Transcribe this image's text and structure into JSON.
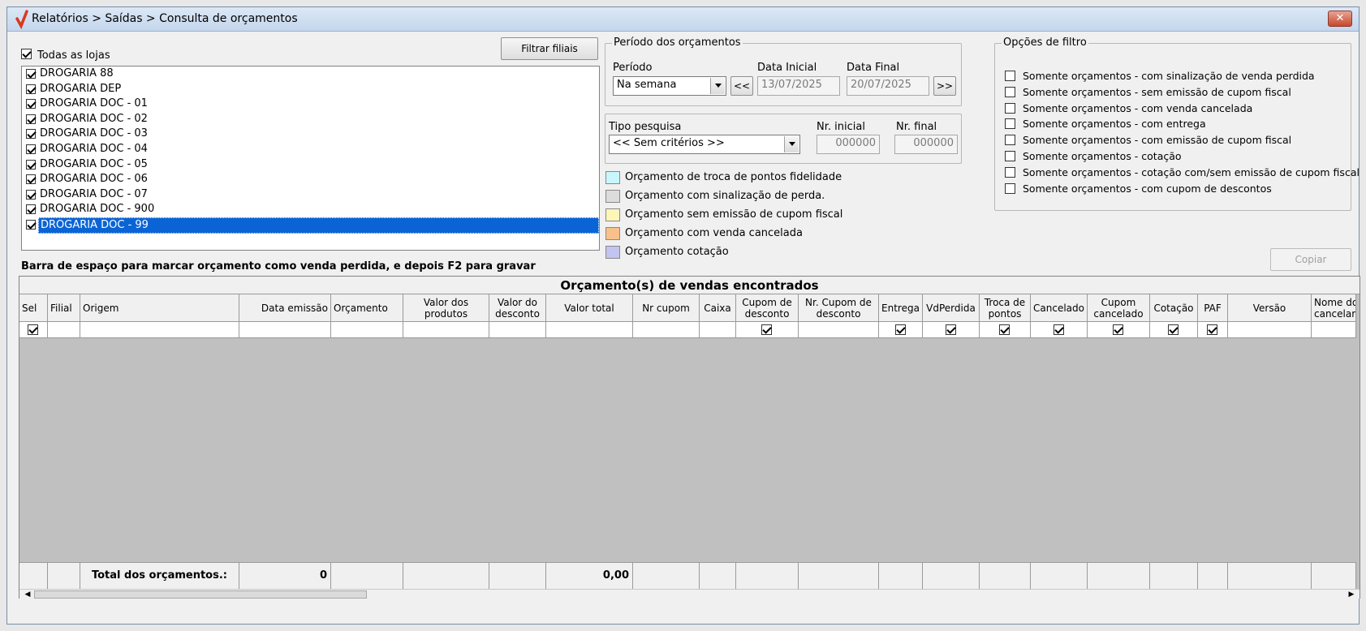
{
  "window": {
    "title": "Relatórios > Saídas > Consulta de orçamentos",
    "close_label": "✕"
  },
  "stores": {
    "all_label": "Todas as lojas",
    "all_checked": true,
    "filter_button": "Filtrar filiais",
    "items": [
      {
        "name": "DROGARIA 88",
        "checked": true
      },
      {
        "name": "DROGARIA DEP",
        "checked": true
      },
      {
        "name": "DROGARIA DOC - 01",
        "checked": true
      },
      {
        "name": "DROGARIA DOC - 02",
        "checked": true
      },
      {
        "name": "DROGARIA DOC - 03",
        "checked": true
      },
      {
        "name": "DROGARIA DOC - 04",
        "checked": true
      },
      {
        "name": "DROGARIA DOC - 05",
        "checked": true
      },
      {
        "name": "DROGARIA DOC - 06",
        "checked": true
      },
      {
        "name": "DROGARIA DOC - 07",
        "checked": true
      },
      {
        "name": "DROGARIA DOC - 900",
        "checked": true
      },
      {
        "name": "DROGARIA DOC - 99",
        "checked": true,
        "selected": true
      }
    ]
  },
  "period": {
    "legend": "Período dos orçamentos",
    "period_label": "Período",
    "period_value": "Na semana",
    "start_label": "Data Inicial",
    "start_value": "13/07/2025",
    "end_label": "Data Final",
    "end_value": "20/07/2025",
    "prev_label": "<<",
    "next_label": ">>"
  },
  "search": {
    "type_label": "Tipo pesquisa",
    "type_value": "<< Sem critérios >>",
    "nr_start_label": "Nr. inicial",
    "nr_start_value": "000000",
    "nr_end_label": "Nr. final",
    "nr_end_value": "000000"
  },
  "color_legend": [
    {
      "label": "Orçamento de troca de pontos fidelidade",
      "color": "#c8f6fb"
    },
    {
      "label": "Orçamento com sinalização de perda.",
      "color": "#dcdcdc"
    },
    {
      "label": "Orçamento sem emissão de cupom fiscal",
      "color": "#fdf6b8"
    },
    {
      "label": "Orçamento com venda cancelada",
      "color": "#f8c18c"
    },
    {
      "label": "Orçamento cotação",
      "color": "#c4c4f2"
    }
  ],
  "filter_options": {
    "legend": "Opções de filtro",
    "items": [
      "Somente orçamentos - com sinalização de venda perdida",
      "Somente orçamentos - sem emissão de cupom fiscal",
      "Somente orçamentos - com venda cancelada",
      "Somente orçamentos - com entrega",
      "Somente orçamentos - com emissão de cupom fiscal",
      "Somente orçamentos - cotação",
      "Somente orçamentos - cotação com/sem emissão de cupom fiscal",
      "Somente orçamentos - com cupom de descontos"
    ]
  },
  "copy_button": "Copiar",
  "hint": "Barra de espaço para marcar orçamento como venda perdida, e depois F2 para gravar",
  "grid": {
    "title": "Orçamento(s) de vendas encontrados",
    "columns": [
      "Sel",
      "Filial",
      "Origem",
      "Data emissão",
      "Orçamento",
      "Valor dos produtos",
      "Valor do desconto",
      "Valor total",
      "Nr cupom",
      "Caixa",
      "Cupom de desconto",
      "Nr. Cupom de desconto",
      "Entrega",
      "VdPerdida",
      "Troca de pontos",
      "Cancelado",
      "Cupom cancelado",
      "Cotação",
      "PAF",
      "Versão",
      "Nome do cancelamento"
    ],
    "total_label": "Total dos orçamentos.:",
    "total_count": "0",
    "total_value": "0,00"
  }
}
